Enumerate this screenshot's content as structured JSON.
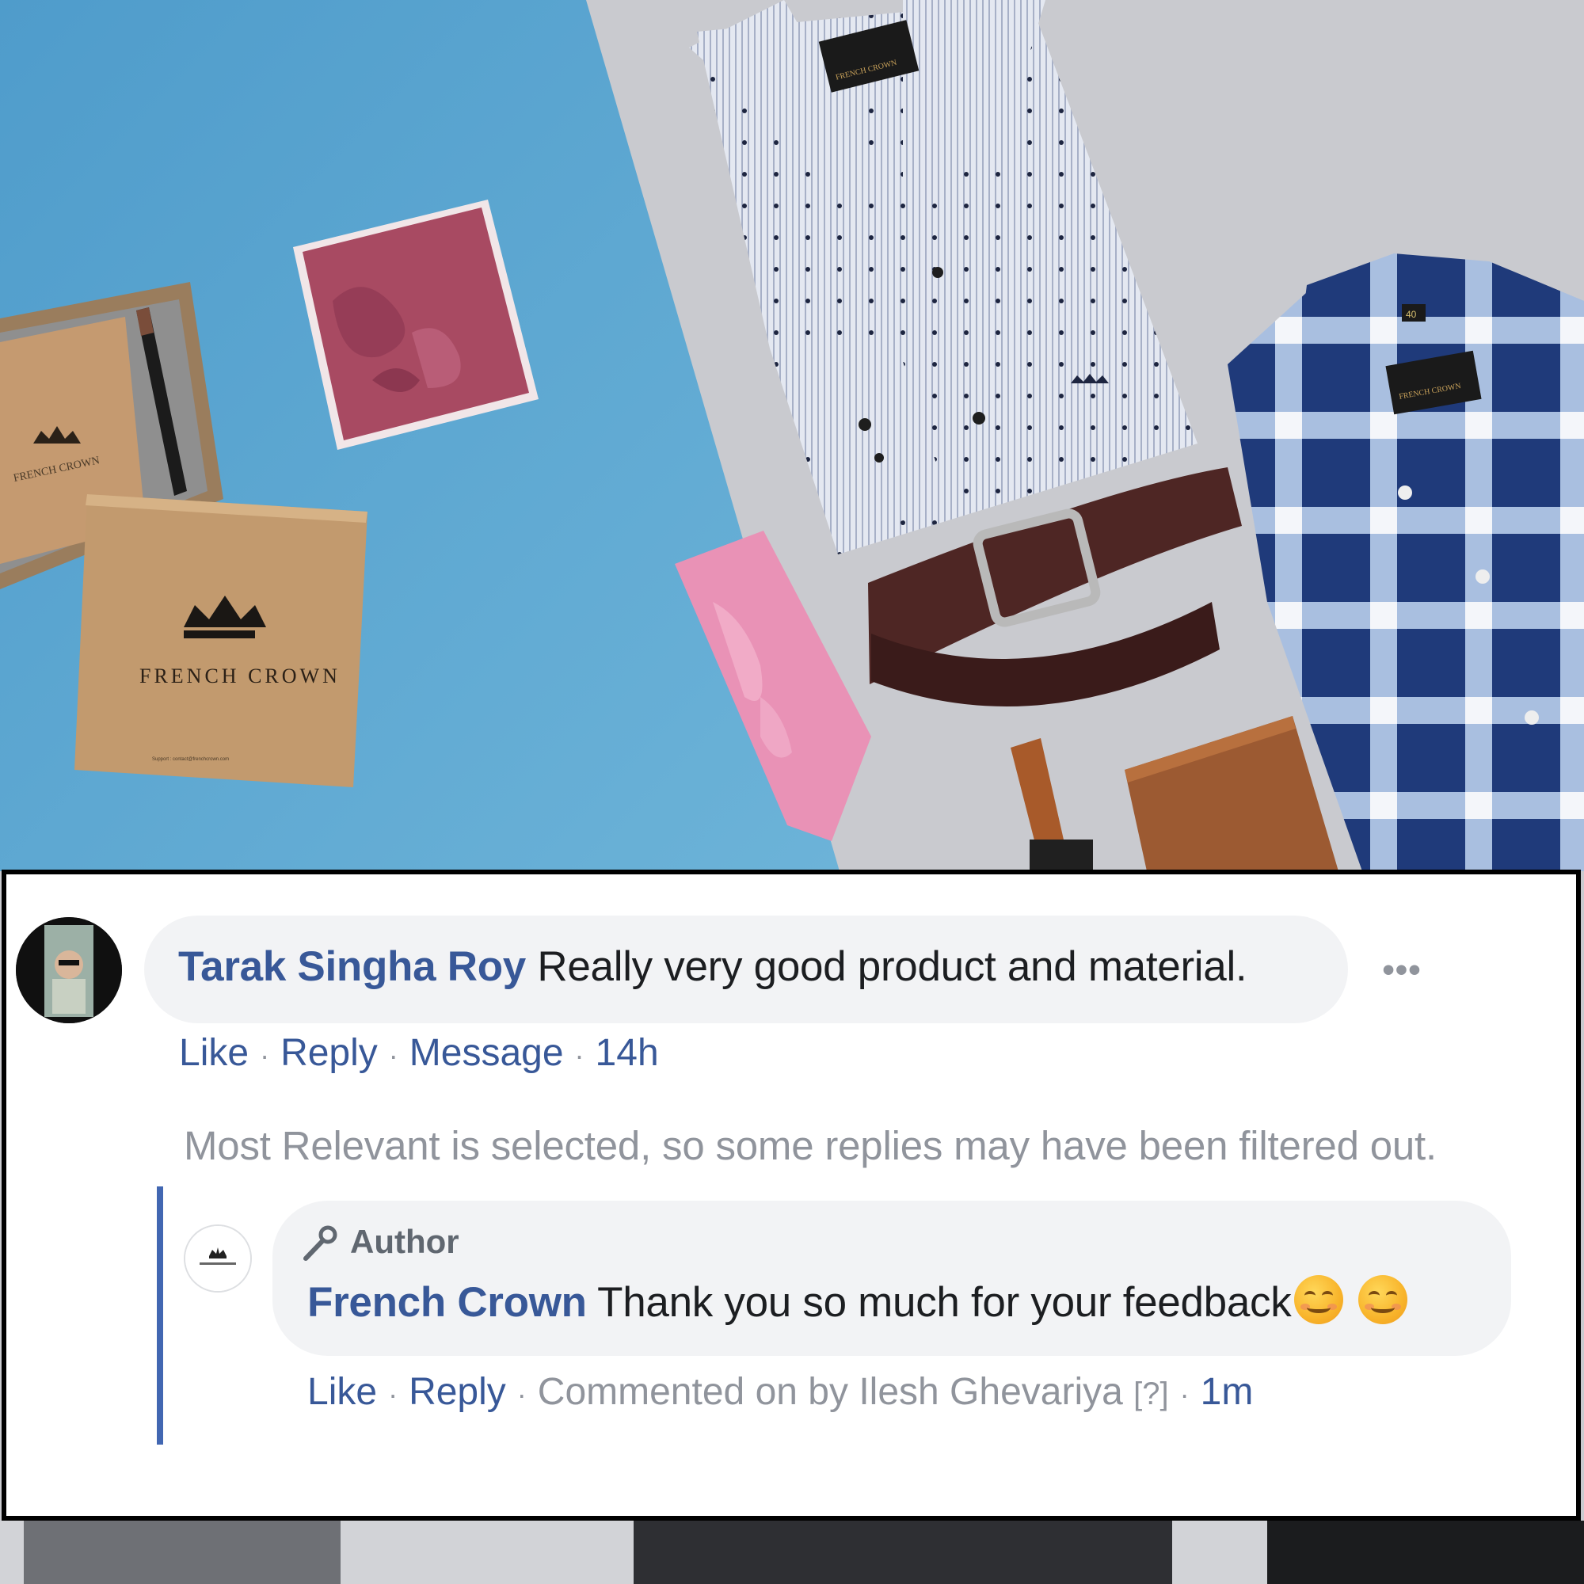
{
  "photo": {
    "brand_box_text": "FRENCH CROWN",
    "brand_box_text_2": "FRENCH CROWN",
    "shirt_label_1": "FRENCH CROWN",
    "shirt_label_2": "FRENCH CROWN",
    "shirt_size": "40",
    "box_support_text": "Support : contact@frenchcrown.com"
  },
  "comment": {
    "author": "Tarak Singha Roy",
    "text": "Really very good product and material.",
    "more_icon": "•••",
    "actions": {
      "like": "Like",
      "reply": "Reply",
      "message": "Message",
      "time": "14h"
    }
  },
  "filter_note": "Most Relevant is selected, so some replies may have been filtered out.",
  "reply": {
    "badge": "Author",
    "author": "French Crown",
    "text": "Thank you so much for your feedback",
    "emoji_icon": "smiling-face-emoji",
    "actions": {
      "like": "Like",
      "reply": "Reply",
      "commented_by": "Commented on by Ilesh Ghevariya",
      "help": "[?]",
      "time": "1m"
    }
  },
  "colors": {
    "link_blue": "#385898",
    "muted_gray": "#90949c",
    "bubble_bg": "#f2f3f5",
    "thread_line": "#4267b2",
    "photo_blue": "#5fa6cf",
    "photo_gray": "#c9cacf"
  }
}
